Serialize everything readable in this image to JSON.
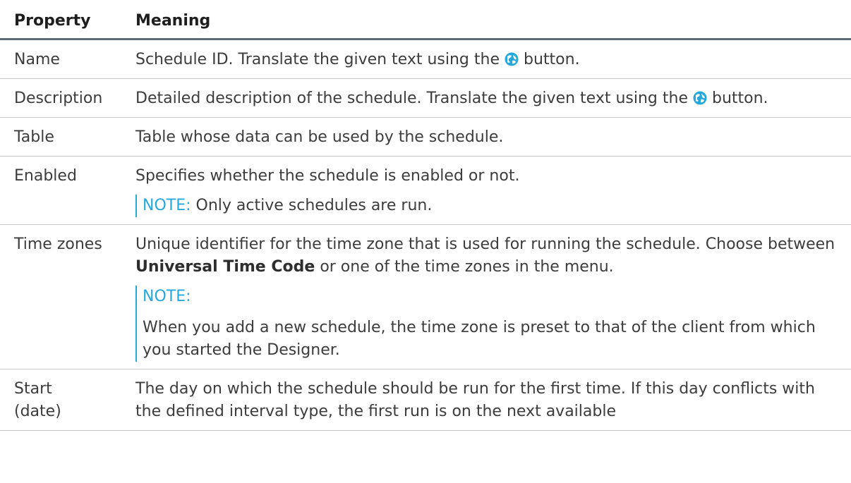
{
  "headers": {
    "property": "Property",
    "meaning": "Meaning"
  },
  "icons": {
    "translate": "translate-globe-icon",
    "accent_color": "#25a9dd"
  },
  "rows": [
    {
      "property": "Name",
      "meaning_before": "Schedule ID. Translate the given text using the",
      "meaning_after": "button."
    },
    {
      "property": "Description",
      "meaning_before": "Detailed description of the schedule. Translate the given text using the",
      "meaning_after": "button."
    },
    {
      "property": "Table",
      "meaning": "Table whose data can be used by the schedule."
    },
    {
      "property": "Enabled",
      "meaning": "Specifies whether the schedule is enabled or not.",
      "note_label": "NOTE:",
      "note_text": "Only active schedules are run."
    },
    {
      "property": "Time zones",
      "meaning_before": "Unique identifier for the time zone that is used for running the schedule. Choose between",
      "meaning_bold": "Universal Time Code",
      "meaning_after": "or one of the time zones in the menu.",
      "note_label": "NOTE:",
      "note_text": "When you add a new schedule, the time zone is preset to that of the client from which you started the Designer."
    },
    {
      "property_line1": "Start",
      "property_line2": "(date)",
      "meaning": "The day on which the schedule should be run for the first time. If this day conflicts with the defined interval type, the first run is on the next available"
    }
  ]
}
